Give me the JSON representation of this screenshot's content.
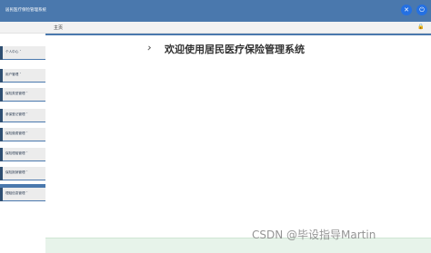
{
  "app": {
    "title": "居民医疗保险管理系统"
  },
  "header": {
    "icons": [
      "close-icon",
      "exit-icon"
    ]
  },
  "breadcrumb": {
    "label": "主页"
  },
  "sidebar": {
    "items": [
      {
        "label": "个人中心 ˅"
      },
      {
        "label": "用户管理 ˅"
      },
      {
        "label": "保险类型管理 ˅"
      },
      {
        "label": "参保登记管理 ˅"
      },
      {
        "label": "保险缴费管理 ˅"
      },
      {
        "label": "保险理赔管理 ˅"
      },
      {
        "label": "保险报销管理 ˅"
      },
      {
        "label": "理赔信息管理 ˅"
      }
    ]
  },
  "main": {
    "welcome": "欢迎使用居民医疗保险管理系统"
  },
  "watermark": "CSDN @毕设指导Martin",
  "colors": {
    "topbar": "#4a78ad",
    "accent": "#2470e2",
    "sidebar_edge": "#2f4f72",
    "sidebar_item_bg": "#ececec"
  }
}
